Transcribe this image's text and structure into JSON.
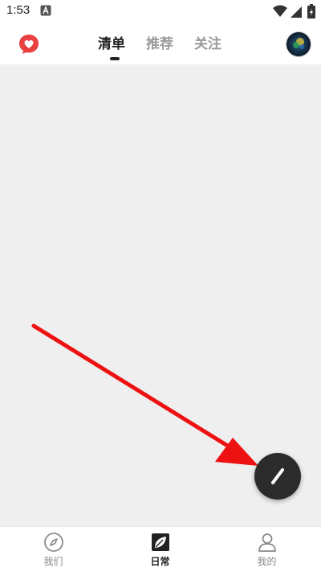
{
  "status_bar": {
    "time": "1:53"
  },
  "header": {
    "tabs": [
      {
        "label": "清单",
        "active": true
      },
      {
        "label": "推荐",
        "active": false
      },
      {
        "label": "关注",
        "active": false
      }
    ]
  },
  "bottom_nav": {
    "items": [
      {
        "label": "我们",
        "icon": "compass-icon",
        "active": false
      },
      {
        "label": "日常",
        "icon": "leaf-icon",
        "active": true
      },
      {
        "label": "我的",
        "icon": "person-icon",
        "active": false
      }
    ]
  },
  "colors": {
    "accent_red": "#e8413f",
    "fab": "#2b2b2b",
    "arrow": "#ee1111",
    "content_bg": "#efefef"
  }
}
